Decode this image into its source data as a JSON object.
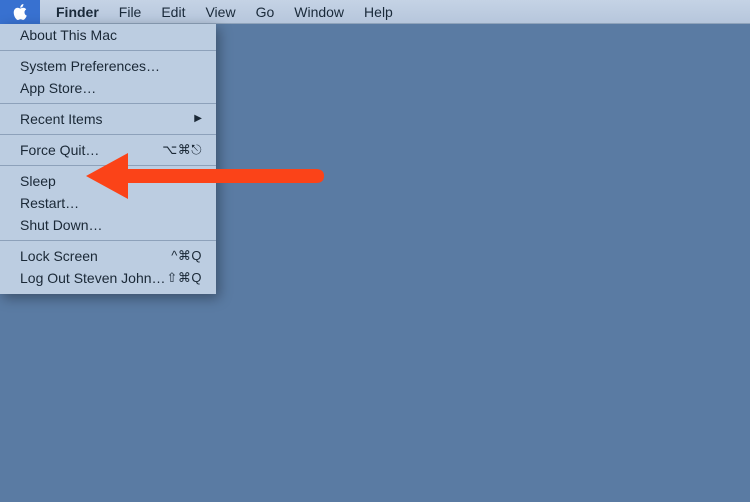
{
  "menubar": {
    "active_app": "Finder",
    "items": [
      "File",
      "Edit",
      "View",
      "Go",
      "Window",
      "Help"
    ]
  },
  "apple_menu": {
    "about": "About This Mac",
    "sysprefs": "System Preferences…",
    "appstore": "App Store…",
    "recent": "Recent Items",
    "forcequit": "Force Quit…",
    "forcequit_shortcut": "⌥⌘⎋",
    "sleep": "Sleep",
    "restart": "Restart…",
    "shutdown": "Shut Down…",
    "lock": "Lock Screen",
    "lock_shortcut": "^⌘Q",
    "logout": "Log Out Steven John…",
    "logout_shortcut": "⇧⌘Q"
  },
  "annotation": {
    "target": "restart",
    "color": "#fb4318"
  }
}
